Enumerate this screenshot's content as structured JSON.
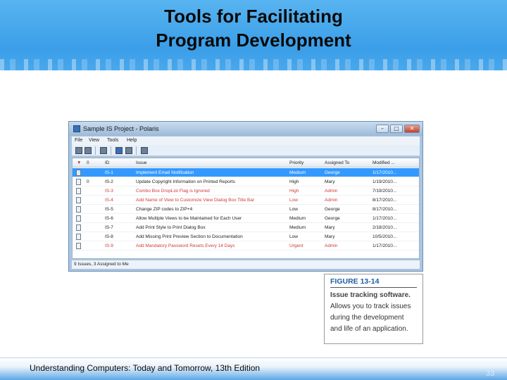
{
  "slide": {
    "title_line1": "Tools for Facilitating",
    "title_line2": "Program Development",
    "footer": "Understanding Computers: Today and Tomorrow, 13th Edition",
    "page_number": "33"
  },
  "window": {
    "title": "Sample IS Project - Polaris",
    "controls": [
      "–",
      "□",
      "✕"
    ],
    "menu": [
      "File",
      "View",
      "Tools",
      "Help"
    ],
    "columns": [
      "▼",
      "0",
      "ID",
      "Issue",
      "Priority",
      "Assigned To",
      "Modified ..."
    ],
    "rows": [
      {
        "flag": "",
        "id": "IS-1",
        "issue": "Implement Email Notification",
        "priority": "Medium",
        "assigned": "George",
        "modified": "1/17/2010...",
        "selected": true,
        "red": false
      },
      {
        "flag": "0",
        "id": "IS-2",
        "issue": "Update Copyright Information on Printed Reports",
        "priority": "High",
        "assigned": "Mary",
        "modified": "1/19/2010...",
        "selected": false,
        "red": false
      },
      {
        "flag": "",
        "id": "IS-3",
        "issue": "Combo Box DropList Flag is Ignored",
        "priority": "High",
        "assigned": "Admin",
        "modified": "7/19/2010...",
        "selected": false,
        "red": true
      },
      {
        "flag": "",
        "id": "IS-4",
        "issue": "Add Name of View to Customize View Dialog Box Title Bar",
        "priority": "Low",
        "assigned": "Admin",
        "modified": "8/17/2010...",
        "selected": false,
        "red": true
      },
      {
        "flag": "",
        "id": "IS-5",
        "issue": "Change ZIP codes to ZIP+4",
        "priority": "Low",
        "assigned": "George",
        "modified": "8/17/2010...",
        "selected": false,
        "red": false
      },
      {
        "flag": "",
        "id": "IS-6",
        "issue": "Allow Multiple Views to be Maintained for Each User",
        "priority": "Medium",
        "assigned": "George",
        "modified": "1/17/2010...",
        "selected": false,
        "red": false
      },
      {
        "flag": "",
        "id": "IS-7",
        "issue": "Add Print Style to Print Dialog Box",
        "priority": "Medium",
        "assigned": "Mary",
        "modified": "2/18/2010...",
        "selected": false,
        "red": false
      },
      {
        "flag": "",
        "id": "IS-8",
        "issue": "Add Missing Print Preview Section to Documentation",
        "priority": "Low",
        "assigned": "Mary",
        "modified": "10/5/2010...",
        "selected": false,
        "red": false
      },
      {
        "flag": "",
        "id": "IS-9",
        "issue": "Add Mandatory Password Resets Every 14 Days",
        "priority": "Urgent",
        "assigned": "Admin",
        "modified": "1/17/2010...",
        "selected": false,
        "red": true
      }
    ],
    "status": "9 Issues, 3 Assigned to Me"
  },
  "caption": {
    "label": "FIGURE 13-14",
    "bold": "Issue tracking software.",
    "text": " Allows you to track issues during the development and life of an application."
  },
  "colors": {
    "header_blue": "#3a9ee8",
    "selection": "#3399ff",
    "red_text": "#d23a3a",
    "caption_label": "#1f5fa6"
  }
}
